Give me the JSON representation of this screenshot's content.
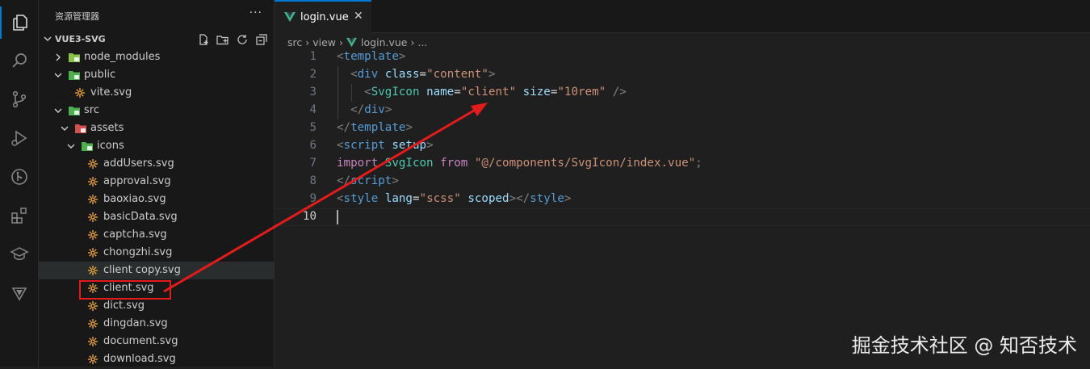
{
  "explorer": {
    "title": "资源管理器",
    "more": "···",
    "project": "VUE3-SVG",
    "tree": [
      {
        "label": "node_modules",
        "icon": "node-modules-folder-icon",
        "chev": "right"
      },
      {
        "label": "public",
        "icon": "public-folder-icon",
        "chev": "down"
      },
      {
        "label": "vite.svg",
        "icon": "svg-file-icon"
      },
      {
        "label": "src",
        "icon": "src-folder-icon",
        "chev": "down"
      },
      {
        "label": "assets",
        "icon": "assets-folder-icon",
        "chev": "down"
      },
      {
        "label": "icons",
        "icon": "icons-folder-icon",
        "chev": "down"
      },
      {
        "label": "addUsers.svg",
        "icon": "svg-file-icon"
      },
      {
        "label": "approval.svg",
        "icon": "svg-file-icon"
      },
      {
        "label": "baoxiao.svg",
        "icon": "svg-file-icon"
      },
      {
        "label": "basicData.svg",
        "icon": "svg-file-icon"
      },
      {
        "label": "captcha.svg",
        "icon": "svg-file-icon"
      },
      {
        "label": "chongzhi.svg",
        "icon": "svg-file-icon"
      },
      {
        "label": "client copy.svg",
        "icon": "svg-file-icon"
      },
      {
        "label": "client.svg",
        "icon": "svg-file-icon"
      },
      {
        "label": "dict.svg",
        "icon": "svg-file-icon"
      },
      {
        "label": "dingdan.svg",
        "icon": "svg-file-icon"
      },
      {
        "label": "document.svg",
        "icon": "svg-file-icon"
      },
      {
        "label": "download.svg",
        "icon": "svg-file-icon"
      }
    ]
  },
  "tab": {
    "label": "login.vue",
    "close": "✕"
  },
  "breadcrumb": {
    "src": "src",
    "view": "view",
    "file": "login.vue",
    "more": "..."
  },
  "editor": {
    "line_numbers": [
      "1",
      "2",
      "3",
      "4",
      "5",
      "6",
      "7",
      "8",
      "9",
      "10"
    ],
    "lines": [
      {
        "p1": "<",
        "t1": "template",
        "p2": ">"
      },
      {
        "indent": "  ",
        "p1": "<",
        "t1": "div",
        "sp": " ",
        "a1": "class",
        "eq": "=",
        "s1": "\"content\"",
        "p2": ">"
      },
      {
        "indent": "    ",
        "p1": "<",
        "c1": "SvgIcon",
        "sp": " ",
        "a1": "name",
        "eq": "=",
        "s1": "\"client\"",
        "sp2": " ",
        "a2": "size",
        "eq2": "=",
        "s2": "\"10rem\"",
        "p2": " />"
      },
      {
        "indent": "  ",
        "p1": "</",
        "t1": "div",
        "p2": ">"
      },
      {
        "p1": "</",
        "t1": "template",
        "p2": ">"
      },
      {
        "p1": "<",
        "t1": "script",
        "sp": " ",
        "a1": "setup",
        "p2": ">"
      },
      {
        "k1": "import",
        "sp": " ",
        "c1": "SvgIcon",
        "sp2": " ",
        "k2": "from",
        "sp3": " ",
        "s1": "\"@/components/SvgIcon/index.vue\"",
        "p2": ";"
      },
      {
        "p1": "</",
        "t1": "script",
        "p2": ">"
      },
      {
        "p1": "<",
        "t1": "style",
        "sp": " ",
        "a1": "lang",
        "eq": "=",
        "s1": "\"scss\"",
        "sp2": " ",
        "a2": "scoped",
        "p2": "></",
        "t2": "style",
        "p3": ">"
      },
      {}
    ]
  },
  "watermark": "掘金技术社区 @ 知否技术",
  "colors": {
    "accent": "#0078d4",
    "highlight": "#e51b1b",
    "svg_icon": "#ffb13b",
    "vue": "#41b883"
  }
}
